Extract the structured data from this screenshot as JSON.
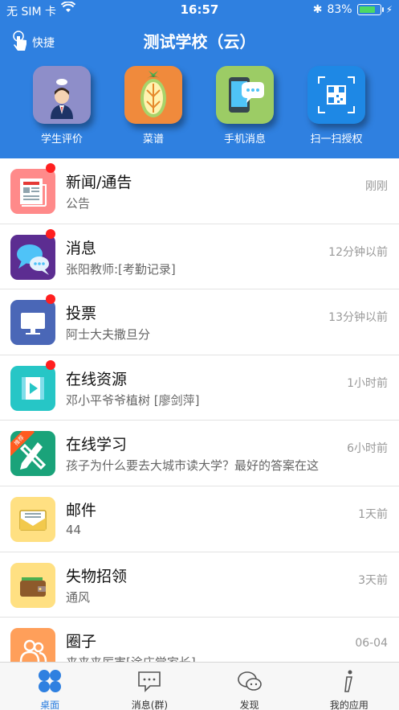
{
  "status": {
    "carrier": "无 SIM 卡",
    "time": "16:57",
    "battery": "83%",
    "battery_level": 0.83
  },
  "header": {
    "quick_label": "快捷",
    "title": "测试学校（云）",
    "color": "#2f80e0"
  },
  "shortcuts": [
    {
      "label": "学生评价",
      "icon": "student-evaluation-icon"
    },
    {
      "label": "菜谱",
      "icon": "recipe-icon"
    },
    {
      "label": "手机消息",
      "icon": "phone-message-icon"
    },
    {
      "label": "扫一扫授权",
      "icon": "qr-scan-icon"
    }
  ],
  "list": [
    {
      "name": "新闻/通告",
      "sub": "公告",
      "time": "刚刚",
      "unread": true,
      "icon": "news-icon"
    },
    {
      "name": "消息",
      "sub": "张阳教师:[考勤记录]",
      "time": "12分钟以前",
      "unread": true,
      "icon": "message-bubbles-icon"
    },
    {
      "name": "投票",
      "sub": "阿士大夫撒旦分",
      "time": "13分钟以前",
      "unread": true,
      "icon": "vote-monitor-icon"
    },
    {
      "name": "在线资源",
      "sub": "邓小平爷爷植树 [廖剑萍]",
      "time": "1小时前",
      "unread": true,
      "icon": "video-resource-icon"
    },
    {
      "name": "在线学习",
      "sub": "孩子为什么要去大城市读大学？最好的答案在这",
      "time": "6小时前",
      "unread": false,
      "badge": "推荐",
      "icon": "pencil-ruler-icon"
    },
    {
      "name": "邮件",
      "sub": "44",
      "time": "1天前",
      "unread": false,
      "icon": "mail-envelope-icon"
    },
    {
      "name": "失物招领",
      "sub": "通风",
      "time": "3天前",
      "unread": false,
      "icon": "wallet-icon"
    },
    {
      "name": "圈子",
      "sub": "来来来厉害[涂庄觉家长]",
      "time": "06-04",
      "unread": false,
      "icon": "people-circle-icon"
    }
  ],
  "tabs": [
    {
      "label": "桌面",
      "icon": "desktop-grid-icon",
      "active": true
    },
    {
      "label": "消息(群)",
      "icon": "chat-icon",
      "active": false
    },
    {
      "label": "发现",
      "icon": "discover-icon",
      "active": false
    },
    {
      "label": "我的应用",
      "icon": "info-icon",
      "active": false
    }
  ]
}
